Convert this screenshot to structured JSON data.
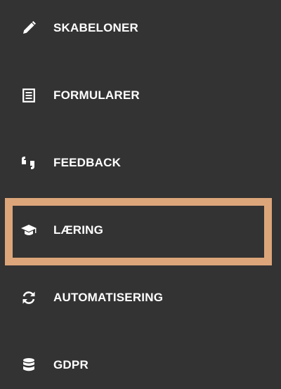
{
  "menu": {
    "items": [
      {
        "label": "SKABELONER",
        "icon": "pencil-icon"
      },
      {
        "label": "FORMULARER",
        "icon": "form-document-icon"
      },
      {
        "label": "FEEDBACK",
        "icon": "quote-icon"
      },
      {
        "label": "LÆRING",
        "icon": "graduation-cap-icon"
      },
      {
        "label": "AUTOMATISERING",
        "icon": "refresh-icon"
      },
      {
        "label": "GDPR",
        "icon": "database-icon"
      }
    ],
    "highlighted_item": "LÆRING"
  },
  "colors": {
    "background": "#333333",
    "text": "#ffffff",
    "highlight": "#dda67a"
  }
}
